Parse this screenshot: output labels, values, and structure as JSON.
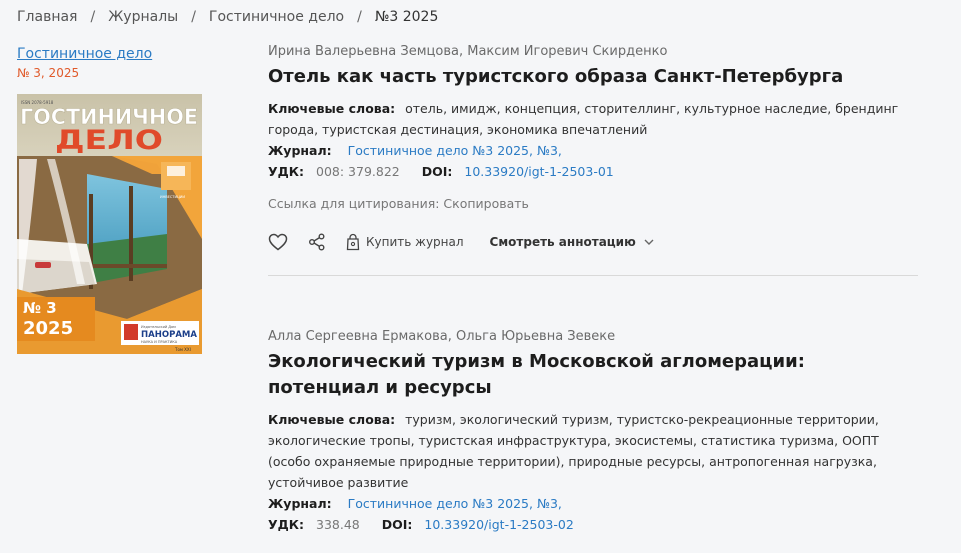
{
  "breadcrumb": {
    "items": [
      "Главная",
      "Журналы",
      "Гостиничное дело"
    ],
    "current": "№3 2025",
    "separator": "/"
  },
  "sidebar": {
    "journal_name": "Гостиничное дело",
    "issue": "№ 3, 2025"
  },
  "cover": {
    "title_line1": "ГОСТИНИЧНОЕ",
    "title_line2": "ДЕЛО",
    "issue_num": "№ 3",
    "year": "2025",
    "publisher_top": "Издательский Дом",
    "publisher_name": "ПАНОРАМА",
    "publisher_sub": "НАУКА И ПРАКТИКА",
    "volume": "Том XXI"
  },
  "labels": {
    "keywords": "Ключевые слова:",
    "journal": "Журнал:",
    "udk": "УДК:",
    "doi": "DOI:",
    "cite": "Ссылка для цитирования: Скопировать",
    "buy": "Купить журнал",
    "annotation": "Смотреть аннотацию"
  },
  "articles": [
    {
      "authors": "Ирина Валерьевна Земцова, Максим Игоревич Скирденко",
      "title": "Отель как часть туристского образа Санкт-Петербурга",
      "keywords": "отель, имидж, концепция, сторителлинг, культурное наследие, брендинг города, туристская дестинация, экономика впечатлений",
      "journal": "Гостиничное дело №3 2025, №3,",
      "udk": "008: 379.822",
      "doi": "10.33920/igt-1-2503-01"
    },
    {
      "authors": "Алла Сергеевна Ермакова, Ольга Юрьевна Зевеке",
      "title": "Экологический туризм в Московской агломерации: потенциал и ресурсы",
      "keywords": "туризм, экологический туризм, туристско-рекреационные территории, экологические тропы, туристская инфраструктура, экосистемы, статистика туризма, ООПТ (особо охраняемые природные территории), природные ресурсы, антропогенная нагрузка, устойчивое развитие",
      "journal": "Гостиничное дело №3 2025, №3,",
      "udk": "338.48",
      "doi": "10.33920/igt-1-2503-02"
    }
  ]
}
